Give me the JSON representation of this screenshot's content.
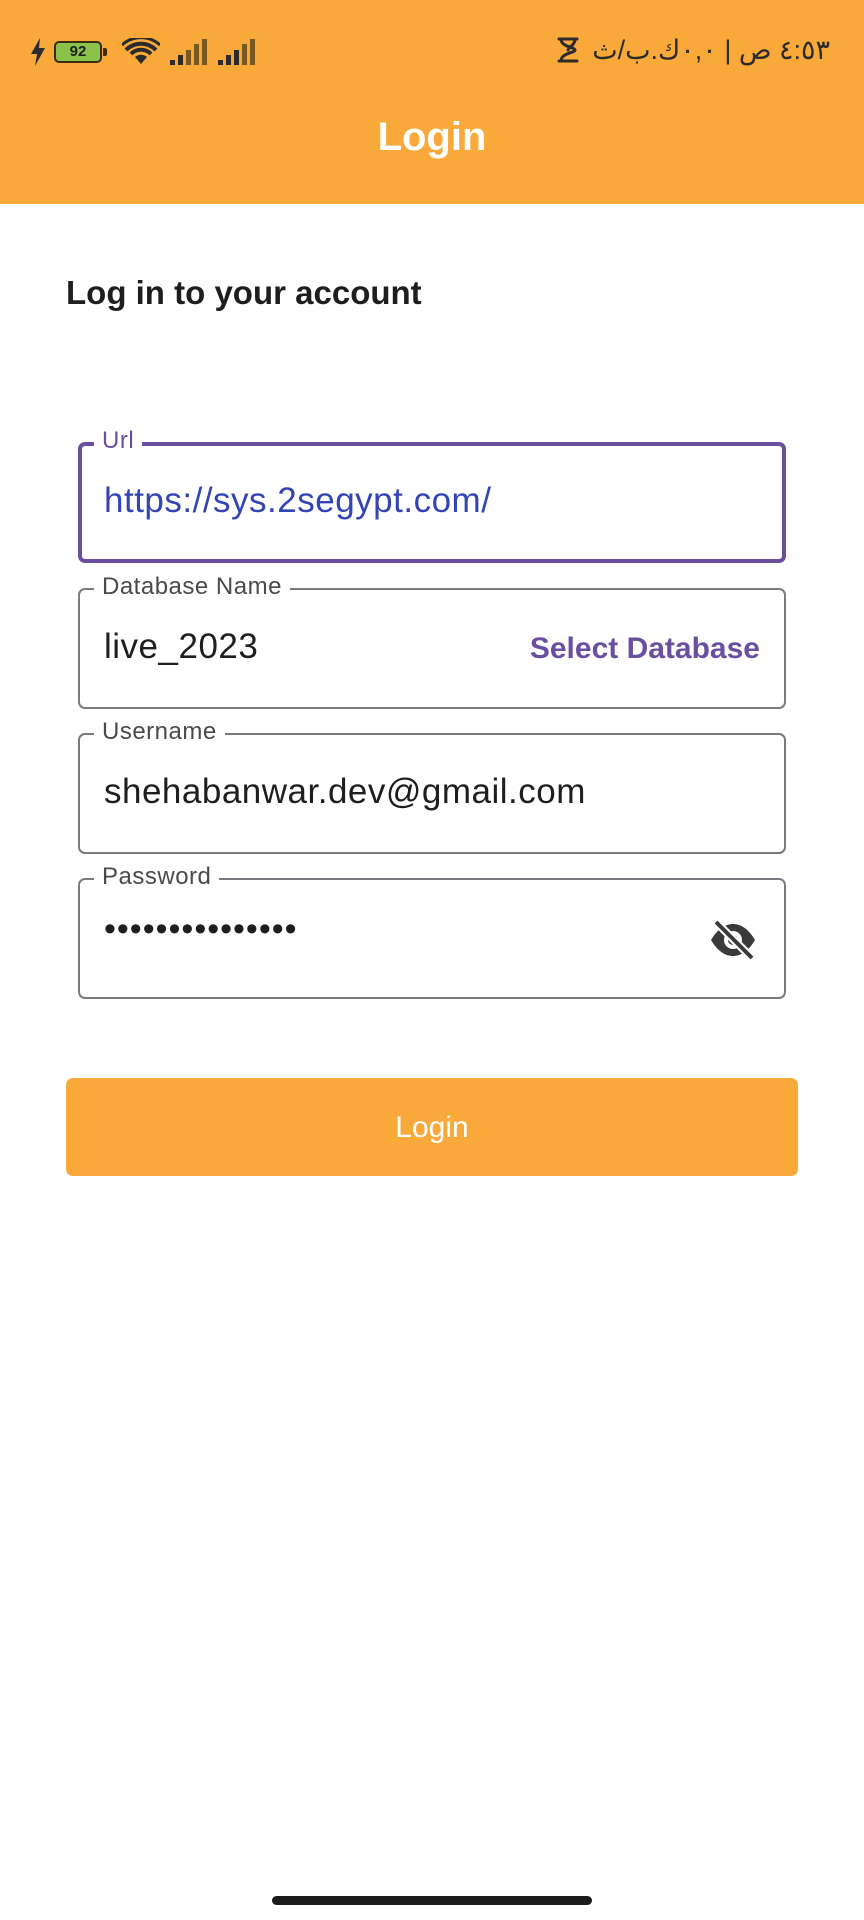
{
  "status_bar": {
    "battery_level": "92",
    "time_text": "٤:٥٣ ص | ٠,٠ك.ب/ث",
    "icons": [
      "charging-bolt-icon",
      "battery-icon",
      "wifi-icon",
      "signal-icon",
      "signal-icon",
      "clock-icon"
    ]
  },
  "app_bar": {
    "title": "Login"
  },
  "form": {
    "heading": "Log in to your account",
    "url": {
      "label": "Url",
      "value": "https://sys.2segypt.com/"
    },
    "database": {
      "label": "Database Name",
      "value": "live_2023",
      "action_label": "Select Database"
    },
    "username": {
      "label": "Username",
      "value": "shehabanwar.dev@gmail.com"
    },
    "password": {
      "label": "Password",
      "value": "•••••••••••••••",
      "visibility_icon": "visibility-off-icon"
    }
  },
  "login_button": {
    "label": "Login"
  },
  "colors": {
    "primary": "#F8A93A",
    "focus": "#6A4FA0",
    "link_text": "#3345B4"
  }
}
